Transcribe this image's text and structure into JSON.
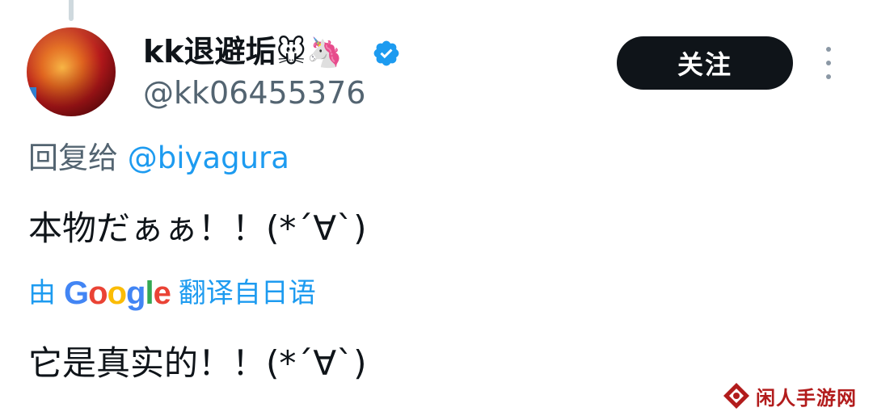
{
  "user": {
    "display_name": "kk退避垢",
    "name_emojis": "🐭🦄",
    "handle": "@kk06455376",
    "verified_icon": "verified-badge-icon",
    "avatar_icon": "avatar-image"
  },
  "actions": {
    "follow_label": "关注",
    "more_icon": "more-vertical-icon"
  },
  "reply": {
    "prefix": "回复给 ",
    "handle": "@biyagura"
  },
  "tweet": {
    "text": "本物だぁぁ！！(*´∀`)"
  },
  "translation": {
    "prefix": "由",
    "provider": "Google",
    "suffix": "翻译自日语",
    "text": "它是真实的！！(*´∀`)"
  },
  "colors": {
    "link": "#1d9bf0",
    "secondary_text": "#536471",
    "follow_bg": "#0f1419",
    "google_blue": "#4285F4",
    "google_red": "#EA4335",
    "google_yellow": "#FBBC05",
    "google_green": "#34A853"
  },
  "google_letters": [
    {
      "ch": "G",
      "color": "#4285F4"
    },
    {
      "ch": "o",
      "color": "#EA4335"
    },
    {
      "ch": "o",
      "color": "#FBBC05"
    },
    {
      "ch": "g",
      "color": "#4285F4"
    },
    {
      "ch": "l",
      "color": "#34A853"
    },
    {
      "ch": "e",
      "color": "#EA4335"
    }
  ],
  "watermark": {
    "text": "闲人手游网"
  }
}
